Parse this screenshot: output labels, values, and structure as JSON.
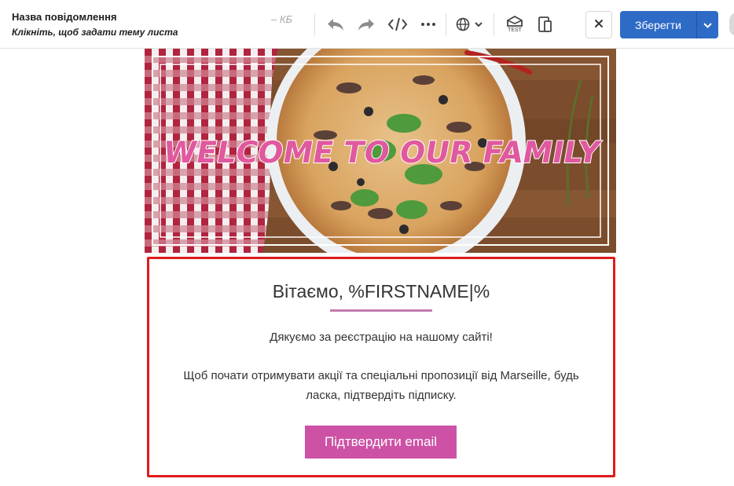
{
  "header": {
    "message_name": "Назва повідомлення",
    "subject_hint": "Клікніть, щоб задати тему листа",
    "size_label": "– КБ",
    "test_label": "TEST",
    "save_label": "Зберегти"
  },
  "icons": {
    "undo": "undo-icon",
    "redo": "redo-icon",
    "code": "code-icon",
    "more": "more-dots-icon",
    "language": "globe-icon",
    "test": "test-send-icon",
    "preview": "device-preview-icon",
    "close": "close-icon",
    "save_dropdown": "chevron-down-icon"
  },
  "banner": {
    "headline": "WELCOME TO OUR FAMILY"
  },
  "content": {
    "greeting": "Вітаємо, %FIRSTNAME|%",
    "thanks": "Дякуємо за реєстрацію на нашому сайті!",
    "body": "Щоб почати отримувати акції та спеціальні пропозиції від Marseille, будь ласка, підтвердіть підписку.",
    "button_label": "Підтвердити email"
  },
  "colors": {
    "save_button": "#2e6bc6",
    "confirm_button": "#cd52a6",
    "selection_border": "#e01b1b",
    "title_underline": "#c07bb0"
  }
}
